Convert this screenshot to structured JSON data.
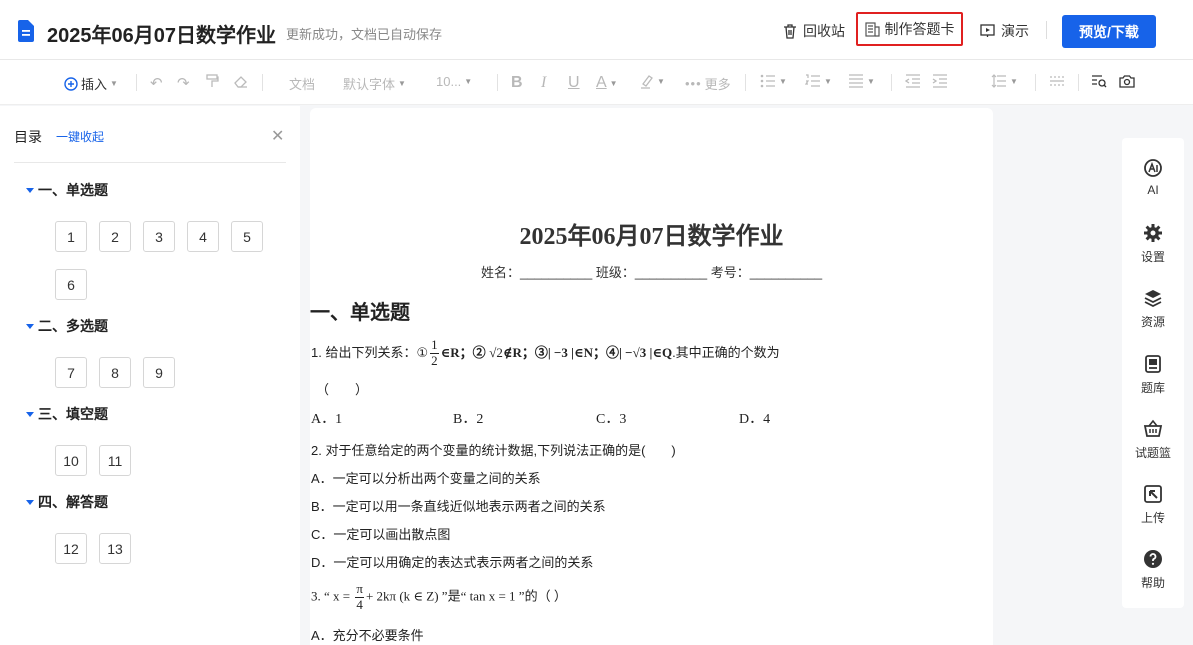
{
  "header": {
    "title": "2025年06月07日数学作业",
    "save_status": "更新成功，文档已自动保存",
    "recycle_label": "回收站",
    "answer_card_label": "制作答题卡",
    "present_label": "演示",
    "preview_label": "预览/下载"
  },
  "toolbar": {
    "insert": "插入",
    "style": "文档",
    "font": "默认字体",
    "size": "10...",
    "more": "更多",
    "bold": "B",
    "italic": "I",
    "underline": "U",
    "font_color": "A"
  },
  "sidebar": {
    "title": "目录",
    "collapse_all": "一键收起",
    "sections": [
      {
        "label": "一、单选题",
        "questions": [
          "1",
          "2",
          "3",
          "4",
          "5",
          "6"
        ]
      },
      {
        "label": "二、多选题",
        "questions": [
          "7",
          "8",
          "9"
        ]
      },
      {
        "label": "三、填空题",
        "questions": [
          "10",
          "11"
        ]
      },
      {
        "label": "四、解答题",
        "questions": [
          "12",
          "13"
        ]
      }
    ]
  },
  "paper": {
    "title": "2025年06月07日数学作业",
    "info": "姓名：__________ 班级：__________ 考号：__________",
    "section1": "一、单选题",
    "q1": {
      "prefix": "1. 给出下列关系：①",
      "frac_num": "1",
      "frac_den": "2",
      "r1": "∈R；②",
      "sqrt2": "√2",
      "r2": "∉R；③| −3 |∈N；④| −√3 |∈Q",
      "suffix": ".其中正确的个数为",
      "paren": "（　　）",
      "options": [
        "A．1",
        "B．2",
        "C．3",
        "D．4"
      ]
    },
    "q2": {
      "stem": "2. 对于任意给定的两个变量的统计数据,下列说法正确的是(　　)",
      "options": [
        "A．一定可以分析出两个变量之间的关系",
        "B．一定可以用一条直线近似地表示两者之间的关系",
        "C．一定可以画出散点图",
        "D．一定可以用确定的表达式表示两者之间的关系"
      ]
    },
    "q3": {
      "prefix": "3. “ x = ",
      "frac_num": "π",
      "frac_den": "4",
      "middle": "+ 2kπ (k ∈ Z) ”是“ tan x = 1 ”的（ ）",
      "option_a": "A．充分不必要条件"
    }
  },
  "right_panel": {
    "items": [
      {
        "label": "AI",
        "icon": "ai-icon"
      },
      {
        "label": "设置",
        "icon": "gear-icon"
      },
      {
        "label": "资源",
        "icon": "layers-icon"
      },
      {
        "label": "题库",
        "icon": "question-bank-icon"
      },
      {
        "label": "试题篮",
        "icon": "basket-icon"
      },
      {
        "label": "上传",
        "icon": "upload-icon"
      },
      {
        "label": "帮助",
        "icon": "help-icon"
      }
    ]
  },
  "colors": {
    "accent": "#1763e9",
    "highlight_border": "#e02020"
  }
}
